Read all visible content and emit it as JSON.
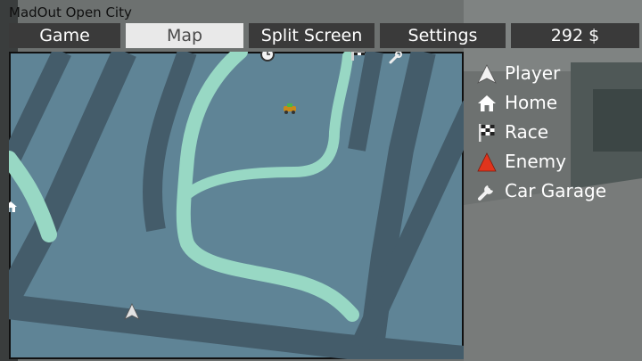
{
  "window": {
    "title": "MadOut Open City"
  },
  "tabs": [
    {
      "label": "Game",
      "active": false
    },
    {
      "label": "Map",
      "active": true
    },
    {
      "label": "Split Screen",
      "active": false
    },
    {
      "label": "Settings",
      "active": false
    },
    {
      "label": "292 $",
      "active": false
    }
  ],
  "legend": [
    {
      "label": "Player",
      "icon": "player-arrow-icon"
    },
    {
      "label": "Home",
      "icon": "home-icon"
    },
    {
      "label": "Race",
      "icon": "checkered-flag-icon"
    },
    {
      "label": "Enemy",
      "icon": "enemy-arrow-icon"
    },
    {
      "label": "Car Garage",
      "icon": "wrench-icon"
    }
  ],
  "map": {
    "markers": [
      "clock-icon",
      "checkered-flag-icon",
      "wrench-icon",
      "car-icon",
      "home-icon",
      "player-arrow-icon"
    ],
    "colors": {
      "ground": "#5f8496",
      "road": "#445c6a",
      "river": "#98d8c4",
      "enemy": "#e0341c"
    }
  }
}
